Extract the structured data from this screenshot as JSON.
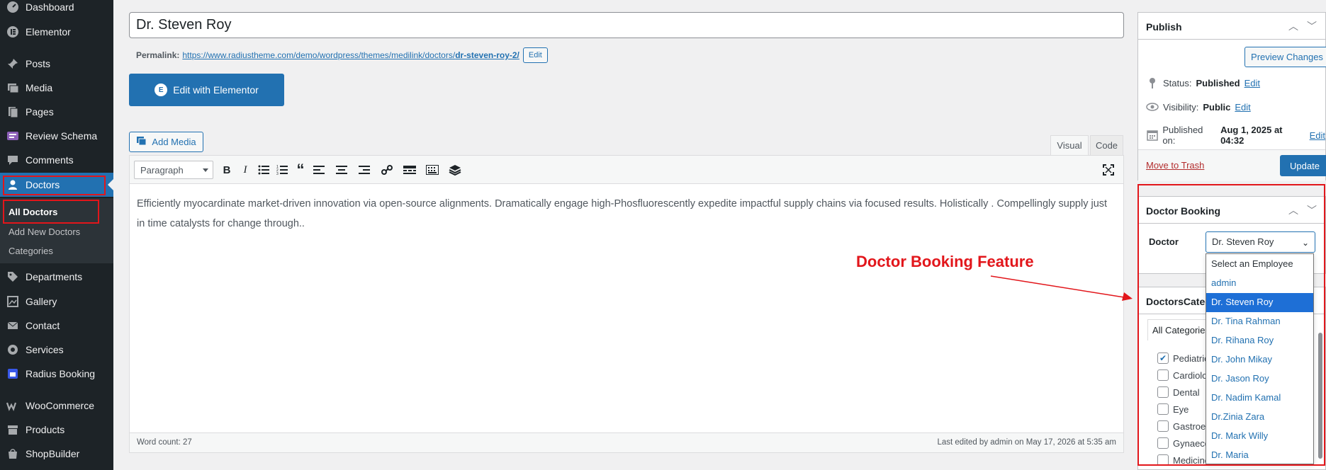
{
  "sidebar": {
    "items": [
      {
        "id": "dashboard",
        "label": "Dashboard"
      },
      {
        "id": "elementor",
        "label": "Elementor"
      },
      {
        "id": "posts",
        "label": "Posts"
      },
      {
        "id": "media",
        "label": "Media"
      },
      {
        "id": "pages",
        "label": "Pages"
      },
      {
        "id": "review-schema",
        "label": "Review Schema"
      },
      {
        "id": "comments",
        "label": "Comments"
      },
      {
        "id": "doctors",
        "label": "Doctors"
      },
      {
        "id": "departments",
        "label": "Departments"
      },
      {
        "id": "gallery",
        "label": "Gallery"
      },
      {
        "id": "contact",
        "label": "Contact"
      },
      {
        "id": "services",
        "label": "Services"
      },
      {
        "id": "radius-booking",
        "label": "Radius Booking"
      },
      {
        "id": "woocommerce",
        "label": "WooCommerce"
      },
      {
        "id": "products",
        "label": "Products"
      },
      {
        "id": "shopbuilder",
        "label": "ShopBuilder"
      }
    ],
    "submenu": [
      {
        "label": "All Doctors"
      },
      {
        "label": "Add New Doctors"
      },
      {
        "label": "Categories"
      }
    ]
  },
  "post": {
    "title": "Dr. Steven Roy",
    "permalink_label": "Permalink:",
    "permalink_base": "https://www.radiustheme.com/demo/wordpress/themes/medilink/doctors/",
    "permalink_slug": "dr-steven-roy-2/",
    "permalink_edit": "Edit"
  },
  "editor": {
    "elementor_button": "Edit with Elementor",
    "add_media": "Add Media",
    "tab_visual": "Visual",
    "tab_code": "Code",
    "format": "Paragraph",
    "content": "Efficiently myocardinate market-driven innovation via open-source alignments. Dramatically engage high-Phosfluorescently expedite impactful supply chains via focused results. Holistically . Compellingly supply just in time catalysts for change through..",
    "word_count": "Word count: 27",
    "last_edited": "Last edited by admin on May 17, 2026 at 5:35 am"
  },
  "publish": {
    "title": "Publish",
    "preview": "Preview Changes",
    "status_label": "Status:",
    "status_value": "Published",
    "visibility_label": "Visibility:",
    "visibility_value": "Public",
    "published_label": "Published on:",
    "published_value": "Aug 1, 2025 at 04:32",
    "edit": "Edit",
    "trash": "Move to Trash",
    "update": "Update"
  },
  "booking": {
    "title": "Doctor Booking",
    "doctor_label": "Doctor",
    "selected": "Dr. Steven Roy",
    "options": [
      "Select an Employee",
      "admin",
      "Dr. Steven Roy",
      "Dr. Tina Rahman",
      "Dr. Rihana Roy",
      "Dr. John Mikay",
      "Dr. Jason Roy",
      "Dr. Nadim Kamal",
      "Dr.Zinia Zara",
      "Dr. Mark Willy",
      "Dr. Maria"
    ]
  },
  "categories": {
    "title": "DoctorsCategories",
    "tab": "All Categories",
    "items": [
      {
        "label": "Pediatrics",
        "checked": true
      },
      {
        "label": "Cardiology",
        "checked": false
      },
      {
        "label": "Dental",
        "checked": false
      },
      {
        "label": "Eye",
        "checked": false
      },
      {
        "label": "Gastroenterology",
        "checked": false
      },
      {
        "label": "Gynaecology",
        "checked": false
      },
      {
        "label": "Medicine",
        "checked": false
      }
    ]
  },
  "annotation": {
    "label": "Doctor Booking Feature",
    "color": "#e2161b"
  },
  "colors": {
    "sidebar_bg": "#1d2327",
    "accent": "#2271b1",
    "annotation": "#e2161b"
  }
}
